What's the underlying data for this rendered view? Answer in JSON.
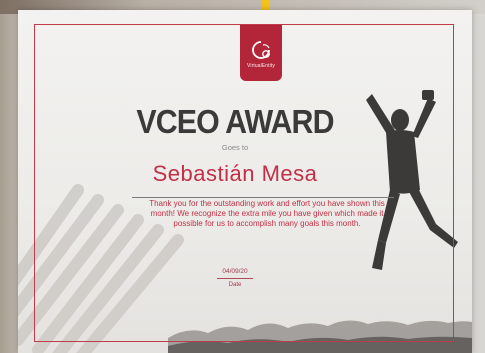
{
  "certificate": {
    "logo_text": "VirtualEntity",
    "title": "VCEO AWARD",
    "goes_to": "Goes to",
    "recipient": "Sebastián Mesa",
    "message": "Thank you for the outstanding work and effort you have shown this month! We recognize the extra mile you have given which made it possible for us to accomplish many goals this month.",
    "date_value": "04/09/20",
    "date_label": "Date"
  },
  "colors": {
    "accent": "#c13047",
    "logo_bg": "#b3263a",
    "title": "#3a3a3a",
    "tab": "#f3c21b"
  },
  "icons": [
    "logo-mark-icon",
    "jumping-person-silhouette",
    "diagonal-stripes-decoration",
    "landscape-silhouette"
  ]
}
